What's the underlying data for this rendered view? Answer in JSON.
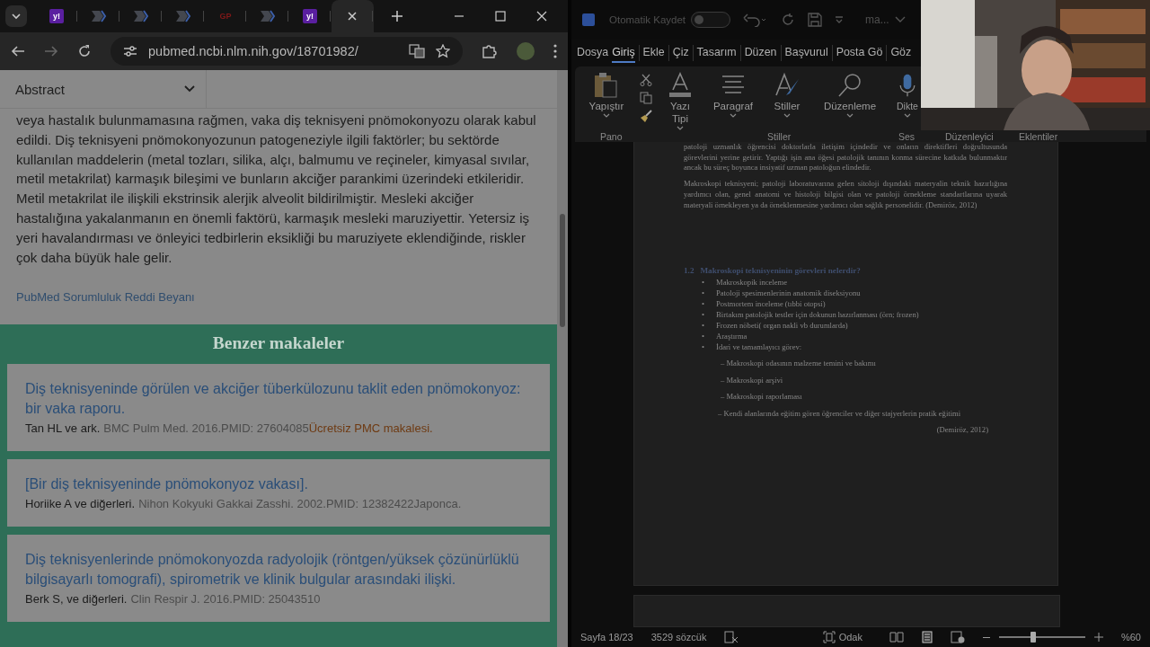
{
  "browser": {
    "tabs": [
      {
        "kind": "yahoo",
        "icon_text": "y!",
        "selected": false
      },
      {
        "kind": "chevron",
        "selected": false
      },
      {
        "kind": "chevron",
        "selected": false
      },
      {
        "kind": "chevron",
        "selected": false
      },
      {
        "kind": "letters",
        "icon_text": "GP",
        "selected": false
      },
      {
        "kind": "chevron",
        "selected": false
      },
      {
        "kind": "yahoo",
        "icon_text": "y!",
        "selected": false
      },
      {
        "kind": "blank",
        "selected": true
      }
    ],
    "url": "pubmed.ncbi.nlm.nih.gov/18701982/",
    "page": {
      "section_select": "Abstract",
      "abstract_text": "veya hastalık bulunmamasına rağmen, vaka diş teknisyeni pnömokonyozu olarak kabul edildi. Diş teknisyeni pnömokonyozunun patogeneziyle ilgili faktörler; bu sektörde kullanılan maddelerin (metal tozları, silika, alçı, balmumu ve reçineler, kimyasal sıvılar, metil metakrilat) karmaşık bileşimi ve bunların akciğer parankimi üzerindeki etkileridir. Metil metakrilat ile ilişkili ekstrinsik alerjik alveolit bildirilmiştir. Mesleki akciğer hastalığına yakalanmanın en önemli faktörü, karmaşık mesleki maruziyettir. Yetersiz iş yeri havalandırması ve önleyici tedbirlerin eksikliği bu maruziyete eklendiğinde, riskler çok daha büyük hale gelir.",
      "disclaimer_link": "PubMed Sorumluluk Reddi Beyanı",
      "similar_heading": "Benzer makaleler",
      "similar_articles": [
        {
          "title": "Diş teknisyeninde görülen ve akciğer tüberkülozunu taklit eden pnömokonyoz: bir vaka raporu.",
          "authors": "Tan HL ve ark.",
          "citation": "BMC Pulm Med. 2016.PMID: 27604085",
          "note": {
            "text": "Ücretsiz PMC makalesi.",
            "color": "#6e3a12"
          }
        },
        {
          "title": "[Bir diş teknisyeninde pnömokonyoz vakası].",
          "authors": "Horiike A ve diğerleri.",
          "citation": "Nihon Kokyuki Gakkai Zasshi. 2002.PMID: 12382422",
          "note": {
            "text": "Japonca.",
            "color": "#4c4c4c"
          }
        },
        {
          "title": "Diş teknisyenlerinde pnömokonyozda radyolojik (röntgen/yüksek çözünürlüklü bilgisayarlı tomografi), spirometrik ve klinik bulgular arasındaki ilişki.",
          "authors": "Berk S, ve diğerleri.",
          "citation": "Clin Respir J. 2016.PMID: 25043510"
        }
      ]
    }
  },
  "word": {
    "autosave_label": "Otomatik Kaydet",
    "autosave_on": false,
    "doc_title": "ma...",
    "menu_tabs": [
      {
        "label": "Dosya",
        "selected": false
      },
      {
        "label": "Giriş",
        "selected": true
      },
      {
        "label": "Ekle",
        "selected": false
      },
      {
        "label": "Çiz",
        "selected": false
      },
      {
        "label": "Tasarım",
        "selected": false
      },
      {
        "label": "Düzen",
        "selected": false
      },
      {
        "label": "Başvurul",
        "selected": false
      },
      {
        "label": "Posta Gö",
        "selected": false
      },
      {
        "label": "Göz",
        "selected": false
      }
    ],
    "ribbon_buttons": [
      {
        "kind": "paste",
        "label": "Yapıştır"
      },
      {
        "kind": "font",
        "label": "Yazı Tipi"
      },
      {
        "kind": "paragraph",
        "label": "Paragraf"
      },
      {
        "kind": "styles",
        "label": "Stiller"
      },
      {
        "kind": "find",
        "label": "Düzenleme"
      },
      {
        "kind": "mic",
        "label": "Dikte"
      }
    ],
    "ribbon_groups": [
      "Pano",
      "Stiller",
      "Ses",
      "Düzenleyici",
      "Eklentiler"
    ],
    "document": {
      "paragraphs": [
        "patoloji uzmanlık öğrencisi doktorlarla iletişim içindedir ve onların direktifleri doğrultusunda görevlerini yerine getirir. Yaptığı işin ana öğesi patolojik tanının konma sürecine katkıda bulunmaktır ancak bu süreç boyunca insiyatif uzman patoloğun elindedir.",
        "Makroskopi teknisyeni; patoloji laboratuvarına gelen sitoloji dışındaki materyalin teknik hazırlığına yardımcı olan, genel anatomi ve histoloji bilgisi olan ve patoloji örnekleme standartlarına uyarak materyali örnekleyen ya da örneklenmesine yardımcı olan sağlık personelidir. (Demiröz, 2012)"
      ],
      "heading_number": "1.2",
      "heading": "Makroskopi teknisyeninin görevleri nelerdir?",
      "bullet_marker": "•",
      "bullets": [
        "Makroskopik inceleme",
        "Patoloji spesimenlerinin anatomik diseksiyonu",
        "Postmortem inceleme (tıbbi otopsi)",
        "Birtakım patolojik testler için dokunun hazırlanması (örn; frozen)",
        "Frozen nöbeti( organ nakli vb durumlarda)",
        "Araştırma",
        "İdari ve tamamlayıcı görev:"
      ],
      "dash_items": [
        "– Makroskopi odasının malzeme temini ve bakımı",
        "– Makroskopi arşivi",
        "– Makroskopi raporlaması",
        "– Kendi alanlarında eğitim gören öğrenciler ve diğer stajyerlerin pratik eğitimi"
      ],
      "citation": "(Demiröz, 2012)"
    },
    "status": {
      "page": "Sayfa 18/23",
      "words": "3529 sözcük",
      "focus": "Odak",
      "zoom_slider": {
        "level": 0.4
      },
      "zoom": "%60"
    }
  }
}
